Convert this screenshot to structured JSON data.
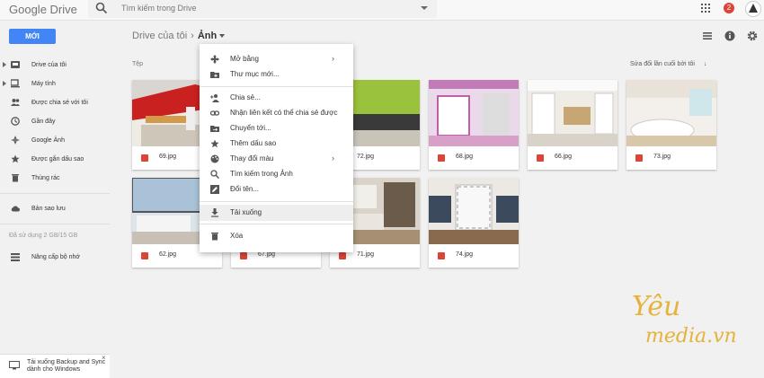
{
  "app": {
    "logo_google": "Google",
    "logo_drive": "Drive"
  },
  "search": {
    "placeholder": "Tìm kiếm trong Drive"
  },
  "notifications": {
    "count": "2"
  },
  "new_button": "MỚI",
  "breadcrumb": {
    "parent": "Drive của tôi",
    "current": "Ảnh"
  },
  "sidebar": {
    "items": [
      {
        "label": "Drive của tôi",
        "icon": "drive-icon"
      },
      {
        "label": "Máy tính",
        "icon": "computer-icon"
      },
      {
        "label": "Được chia sẻ với tôi",
        "icon": "shared-icon"
      },
      {
        "label": "Gần đây",
        "icon": "clock-icon"
      },
      {
        "label": "Google Ảnh",
        "icon": "photos-icon"
      },
      {
        "label": "Được gắn dấu sao",
        "icon": "star-icon"
      },
      {
        "label": "Thùng rác",
        "icon": "trash-icon"
      }
    ],
    "backup": "Bản sao lưu",
    "storage": "Đã sử dụng 2 GB/15 GB",
    "upgrade": "Nâng cấp bộ nhớ"
  },
  "content": {
    "section_label": "Tệp",
    "sort_label": "Sửa đổi lần cuối bởi tôi",
    "files": [
      {
        "name": "69.jpg"
      },
      {
        "name": "72.jpg"
      },
      {
        "name": "68.jpg"
      },
      {
        "name": "66.jpg"
      },
      {
        "name": "73.jpg"
      },
      {
        "name": "62.jpg"
      },
      {
        "name": "67.jpg"
      },
      {
        "name": "71.jpg"
      },
      {
        "name": "74.jpg"
      }
    ]
  },
  "context_menu": {
    "items": [
      {
        "label": "Mở bằng",
        "icon": "open-with-icon",
        "submenu": "›"
      },
      {
        "label": "Thư mục mới...",
        "icon": "new-folder-icon"
      },
      {
        "label": "Chia sẻ...",
        "icon": "share-person-icon"
      },
      {
        "label": "Nhận liên kết có thể chia sẻ được",
        "icon": "link-icon"
      },
      {
        "label": "Chuyển tới...",
        "icon": "move-icon"
      },
      {
        "label": "Thêm dấu sao",
        "icon": "star-icon"
      },
      {
        "label": "Thay đổi màu",
        "icon": "palette-icon",
        "submenu": "›"
      },
      {
        "label": "Tìm kiếm trong Ảnh",
        "icon": "search-icon"
      },
      {
        "label": "Đổi tên...",
        "icon": "rename-icon"
      },
      {
        "label": "Tải xuống",
        "icon": "download-icon"
      },
      {
        "label": "Xóa",
        "icon": "trash-icon"
      }
    ]
  },
  "toast": {
    "line1": "Tải xuống Backup and Sync",
    "line2": "dành cho Windows",
    "close": "×"
  },
  "watermark": {
    "text1": "Yêu",
    "text2": "media.vn"
  },
  "colors": {
    "accent": "#4285f4",
    "danger": "#db4437",
    "watermark": "#e6b23a"
  }
}
